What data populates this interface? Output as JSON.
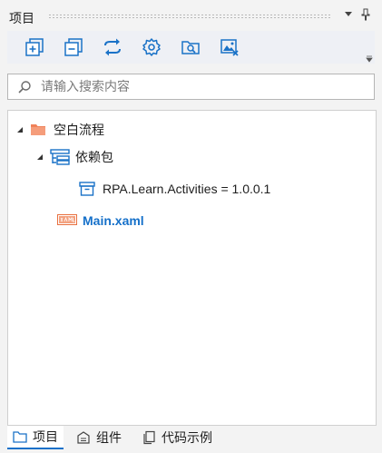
{
  "panel": {
    "title": "项目"
  },
  "search": {
    "placeholder": "请输入搜索内容"
  },
  "tree": {
    "root_label": "空白流程",
    "deps_label": "依赖包",
    "package_label": "RPA.Learn.Activities = 1.0.0.1",
    "file_label": "Main.xaml"
  },
  "tabs": [
    {
      "label": "项目",
      "icon": "folder-icon"
    },
    {
      "label": "组件",
      "icon": "component-icon"
    },
    {
      "label": "代码示例",
      "icon": "copy-icon"
    }
  ],
  "colors": {
    "accent": "#1570c9",
    "folder": "#f0825a",
    "tool_icon": "#1a72c7"
  }
}
